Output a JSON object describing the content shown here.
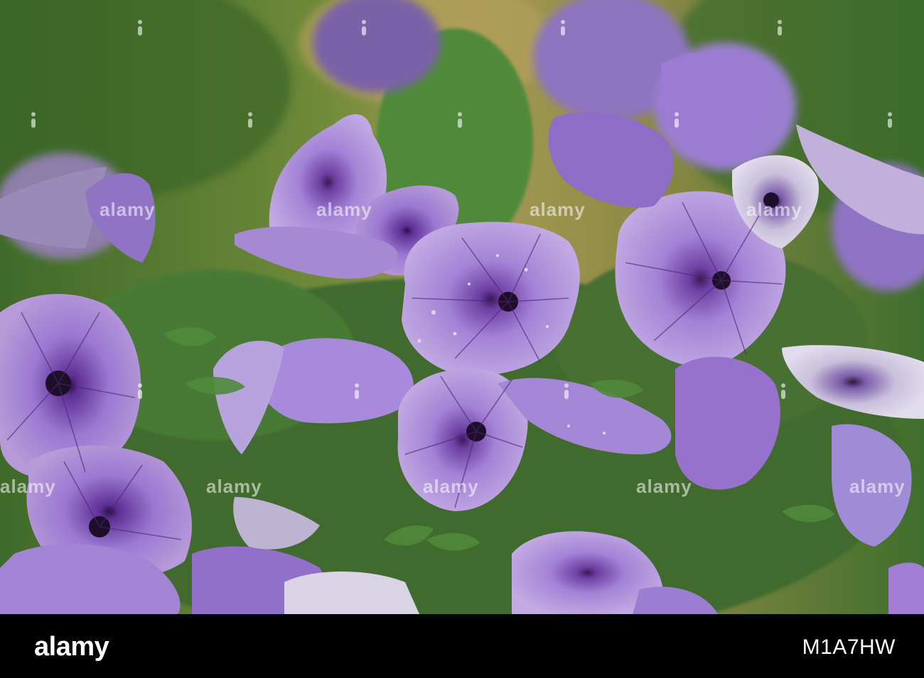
{
  "photo": {
    "subject": "purple petunia flowers",
    "colors": {
      "background_green": "#5f7d3a",
      "background_tan": "#a89a55",
      "petal_light": "#b79ad8",
      "petal_mid": "#9b77cf",
      "vein": "#4b2470",
      "throat": "#1d0f2a",
      "leaf": "#4f8a3a"
    }
  },
  "watermark": {
    "text": "alamy"
  },
  "footer": {
    "logo": "alamy",
    "image_id": "M1A7HW",
    "background": "#000000"
  }
}
